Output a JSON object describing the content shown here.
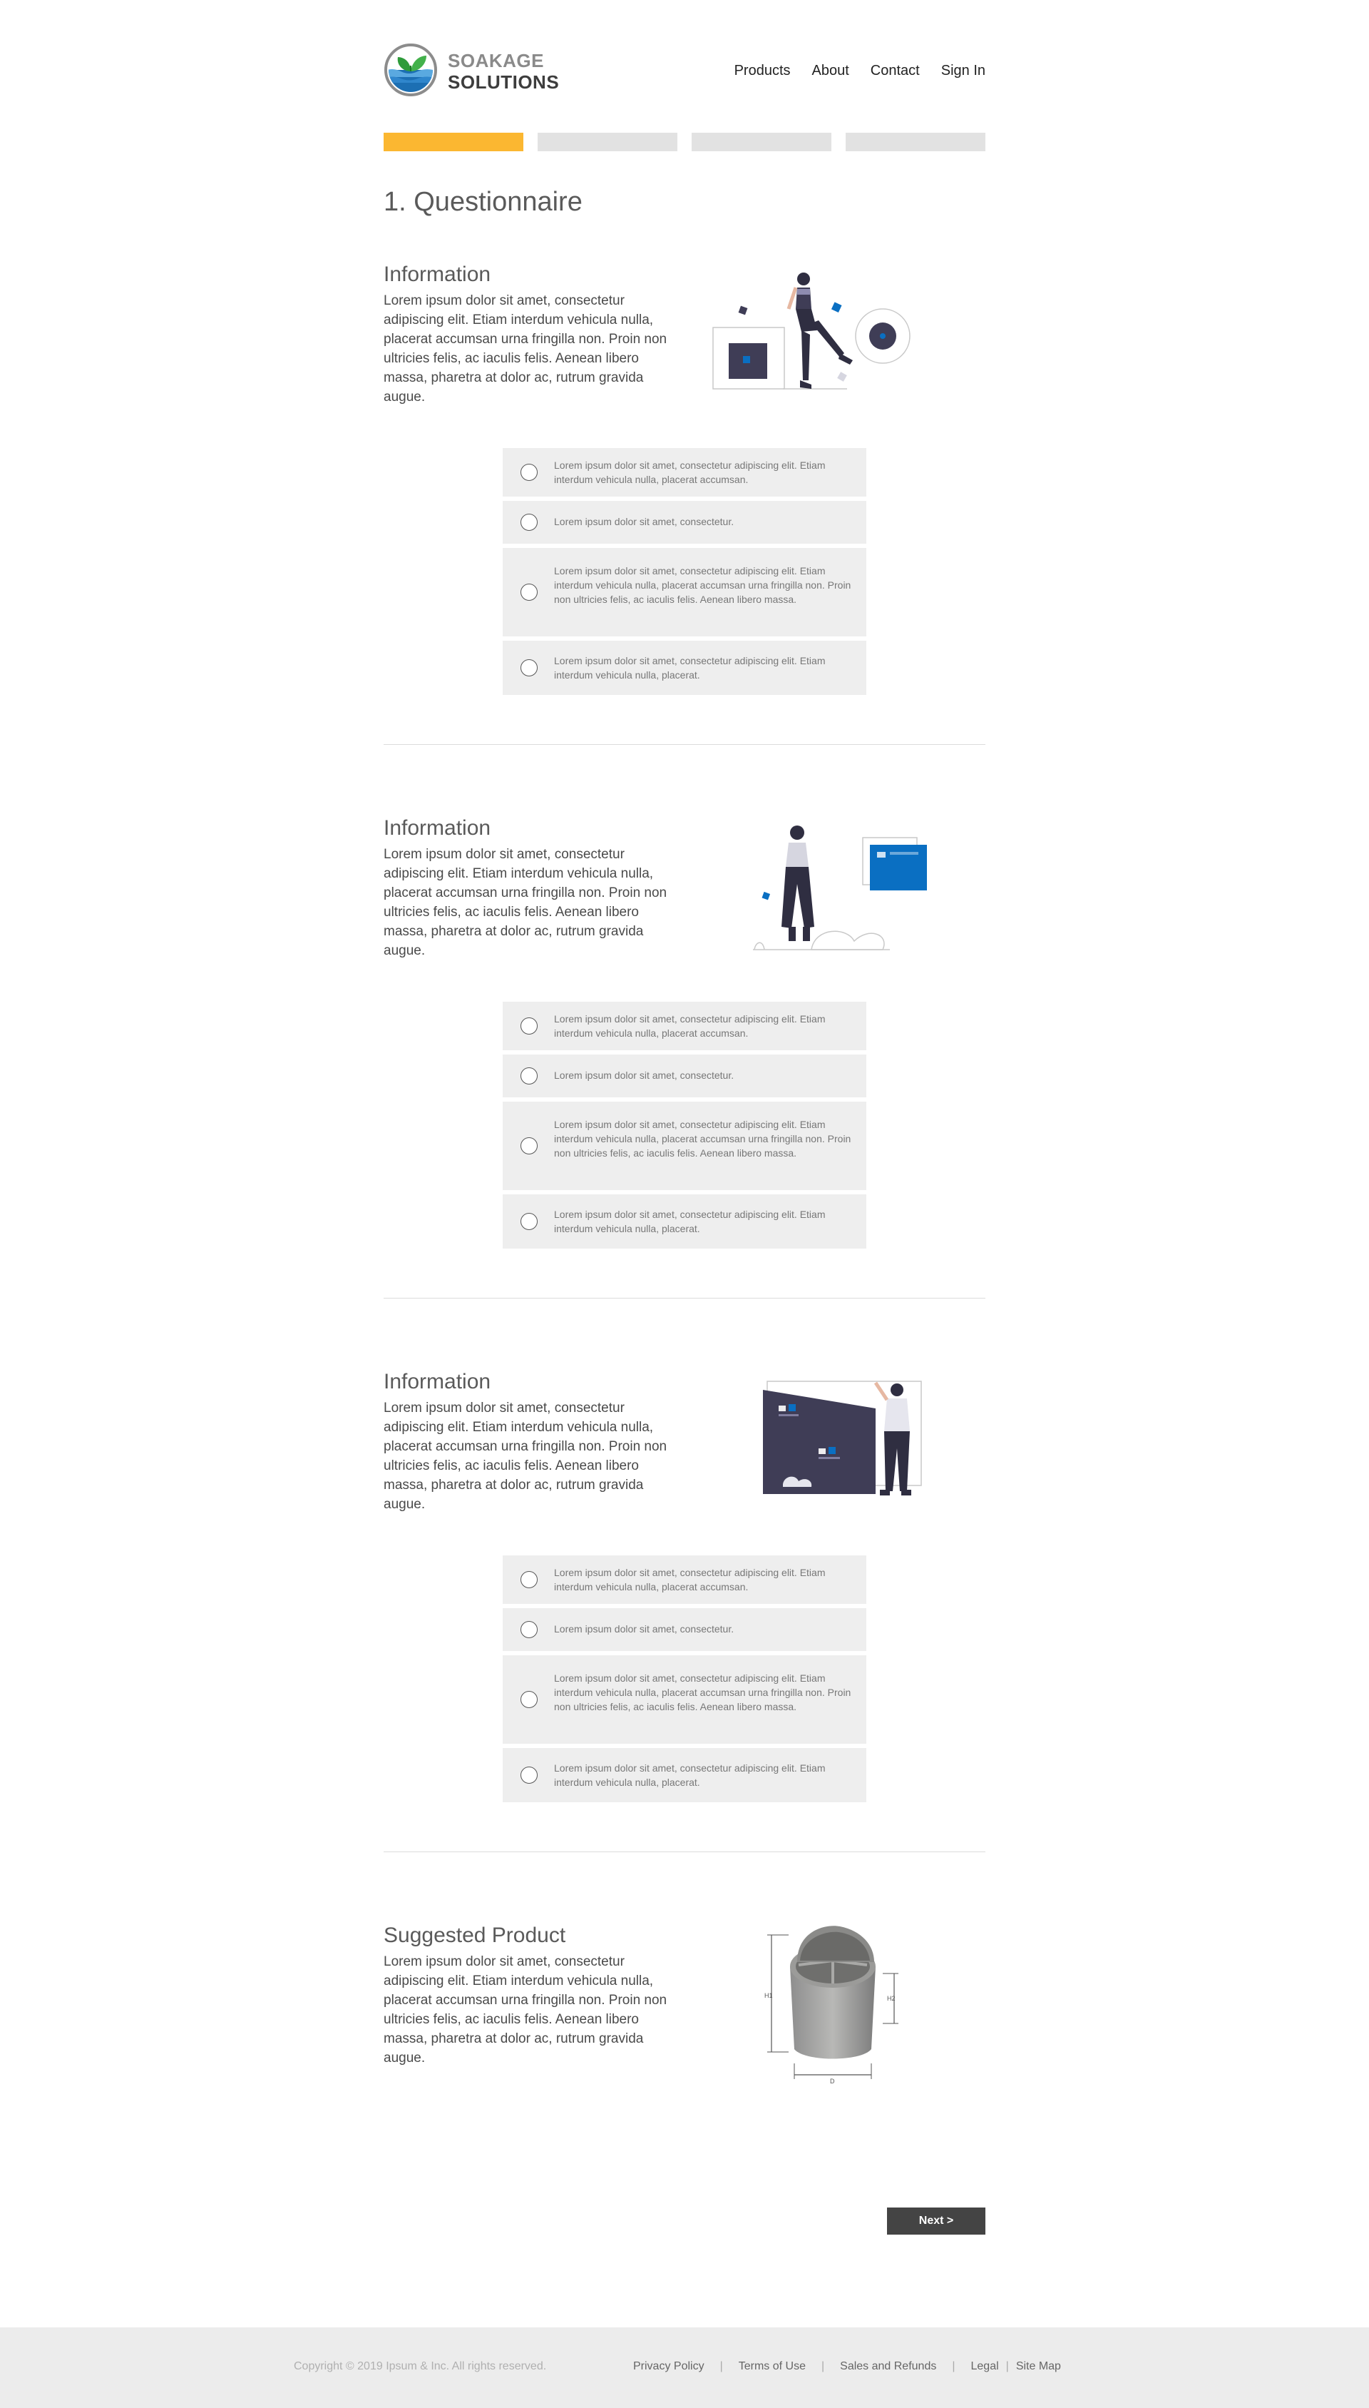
{
  "brand": {
    "name_line1": "SOAKAGE",
    "name_line2": "SOLUTIONS"
  },
  "nav": {
    "items": [
      "Products",
      "About",
      "Contact",
      "Sign In"
    ]
  },
  "progress": {
    "total_steps": 4,
    "current_step": 1
  },
  "page_title": "1. Questionnaire",
  "sections": [
    {
      "title": "Information",
      "text": "Lorem ipsum dolor sit amet, consectetur adipiscing elit. Etiam interdum vehicula nulla, placerat accumsan urna fringilla non. Proin non ultricies felis, ac iaculis felis. Aenean libero massa, pharetra at dolor ac, rutrum gravida augue.",
      "options": [
        "Lorem ipsum dolor sit amet, consectetur adipiscing elit. Etiam interdum vehicula nulla, placerat accumsan.",
        "Lorem ipsum dolor sit amet, consectetur.",
        "Lorem ipsum dolor sit amet, consectetur adipiscing elit. Etiam interdum vehicula nulla, placerat accumsan urna fringilla non. Proin non ultricies felis, ac iaculis felis. Aenean libero massa.",
        "Lorem ipsum dolor sit amet, consectetur adipiscing elit. Etiam interdum vehicula nulla, placerat."
      ]
    },
    {
      "title": "Information",
      "text": "Lorem ipsum dolor sit amet, consectetur adipiscing elit. Etiam interdum vehicula nulla, placerat accumsan urna fringilla non. Proin non ultricies felis, ac iaculis felis. Aenean libero massa, pharetra at dolor ac, rutrum gravida augue.",
      "options": [
        "Lorem ipsum dolor sit amet, consectetur adipiscing elit. Etiam interdum vehicula nulla, placerat accumsan.",
        "Lorem ipsum dolor sit amet, consectetur.",
        "Lorem ipsum dolor sit amet, consectetur adipiscing elit. Etiam interdum vehicula nulla, placerat accumsan urna fringilla non. Proin non ultricies felis, ac iaculis felis. Aenean libero massa.",
        "Lorem ipsum dolor sit amet, consectetur adipiscing elit. Etiam interdum vehicula nulla, placerat."
      ]
    },
    {
      "title": "Information",
      "text": "Lorem ipsum dolor sit amet, consectetur adipiscing elit. Etiam interdum vehicula nulla, placerat accumsan urna fringilla non. Proin non ultricies felis, ac iaculis felis. Aenean libero massa, pharetra at dolor ac, rutrum gravida augue.",
      "options": [
        "Lorem ipsum dolor sit amet, consectetur adipiscing elit. Etiam interdum vehicula nulla, placerat accumsan.",
        "Lorem ipsum dolor sit amet, consectetur.",
        "Lorem ipsum dolor sit amet, consectetur adipiscing elit. Etiam interdum vehicula nulla, placerat accumsan urna fringilla non. Proin non ultricies felis, ac iaculis felis. Aenean libero massa.",
        "Lorem ipsum dolor sit amet, consectetur adipiscing elit. Etiam interdum vehicula nulla, placerat."
      ]
    }
  ],
  "suggested": {
    "title": "Suggested Product",
    "text": "Lorem ipsum dolor sit amet, consectetur adipiscing elit. Etiam interdum vehicula nulla, placerat accumsan urna fringilla non. Proin non ultricies felis, ac iaculis felis. Aenean libero massa, pharetra at dolor ac, rutrum gravida augue.",
    "dimension_labels": [
      "H1",
      "H2",
      "D"
    ]
  },
  "next_label": "Next >",
  "footer": {
    "copyright": "Copyright © 2019 Ipsum & Inc. All rights reserved.",
    "links": [
      "Privacy Policy",
      "Terms of Use",
      "Sales and Refunds",
      "Legal",
      "Site Map"
    ]
  },
  "colors": {
    "accent": "#fbb731",
    "progress_inactive": "#e2e2e2",
    "illustration_dark": "#3f3d56",
    "illustration_blue": "#0a6fc2",
    "button_dark": "#444444"
  }
}
